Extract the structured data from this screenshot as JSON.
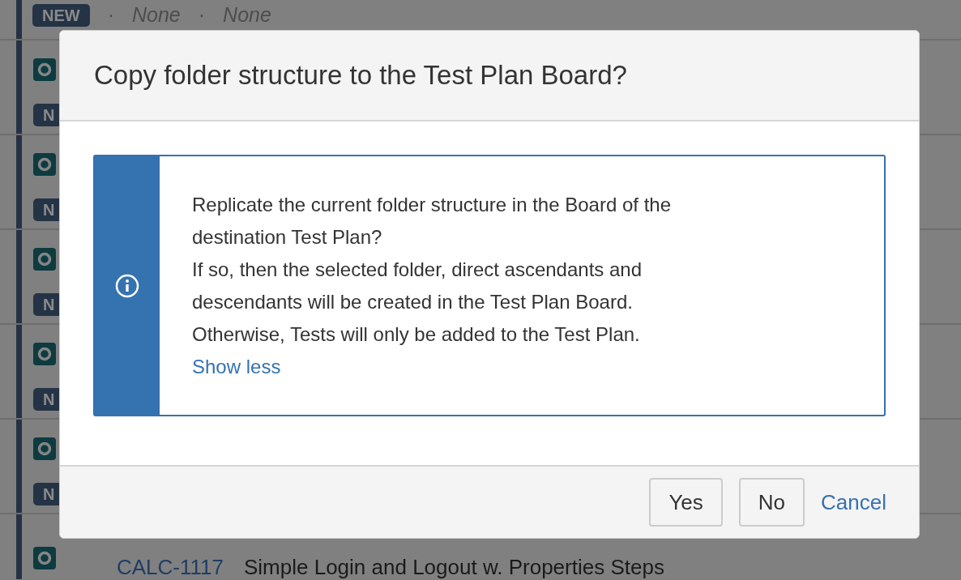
{
  "top_row": {
    "badge": "NEW",
    "separator": "·",
    "values": [
      "None",
      "None"
    ]
  },
  "rows": [
    {
      "badge": "N"
    },
    {
      "badge": "N"
    },
    {
      "badge": "N"
    },
    {
      "badge": "N"
    },
    {
      "badge": "N"
    },
    {
      "key": "CALC-1117",
      "summary": "Simple Login and Logout w. Properties Steps"
    }
  ],
  "dialog": {
    "title": "Copy folder structure to the Test Plan Board?",
    "message_lines": [
      "Replicate the current folder structure in the Board of the",
      "destination Test Plan?",
      "If so, then the selected folder, direct ascendants and",
      "descendants will be created in the Test Plan Board.",
      "Otherwise, Tests will only be added to the Test Plan."
    ],
    "toggle_link": "Show less",
    "buttons": [
      {
        "label": "Yes",
        "kind": "button"
      },
      {
        "label": "No",
        "kind": "button"
      },
      {
        "label": "Cancel",
        "kind": "link"
      }
    ]
  }
}
